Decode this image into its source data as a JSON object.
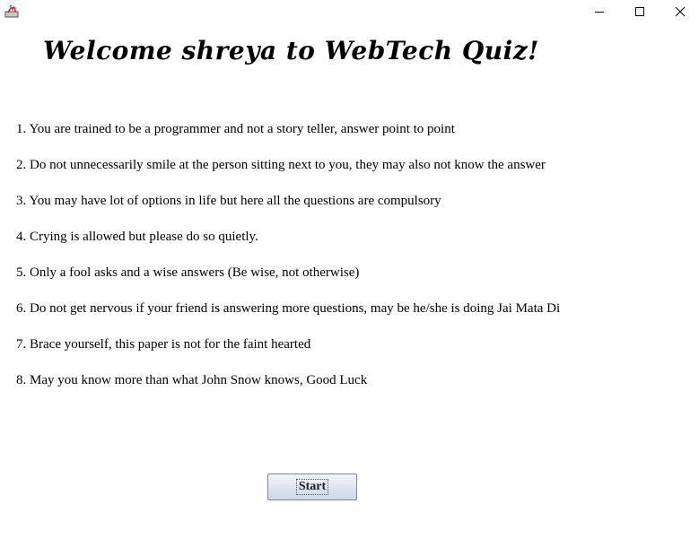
{
  "window": {
    "icons": {
      "app": "java-app-icon",
      "minimize": "minimize-icon",
      "maximize": "maximize-icon",
      "close": "close-icon"
    }
  },
  "header": {
    "welcome": "Welcome shreya to WebTech Quiz!"
  },
  "rules": [
    "1. You are trained to be a programmer and not a story teller, answer point to point",
    "2. Do not unnecessarily smile at the person sitting next to you, they may also not know the answer",
    "3. You may have lot of options in life but here all the questions are compulsory",
    "4. Crying is allowed but please do so quietly.",
    "5. Only a fool asks and a wise answers (Be wise, not otherwise)",
    "6. Do not get nervous if your friend is answering more questions, may be he/she is doing Jai Mata Di",
    "7. Brace yourself, this paper is not for the faint hearted",
    "8. May you know more than what John Snow knows, Good Luck"
  ],
  "actions": {
    "start_label": "Start"
  }
}
